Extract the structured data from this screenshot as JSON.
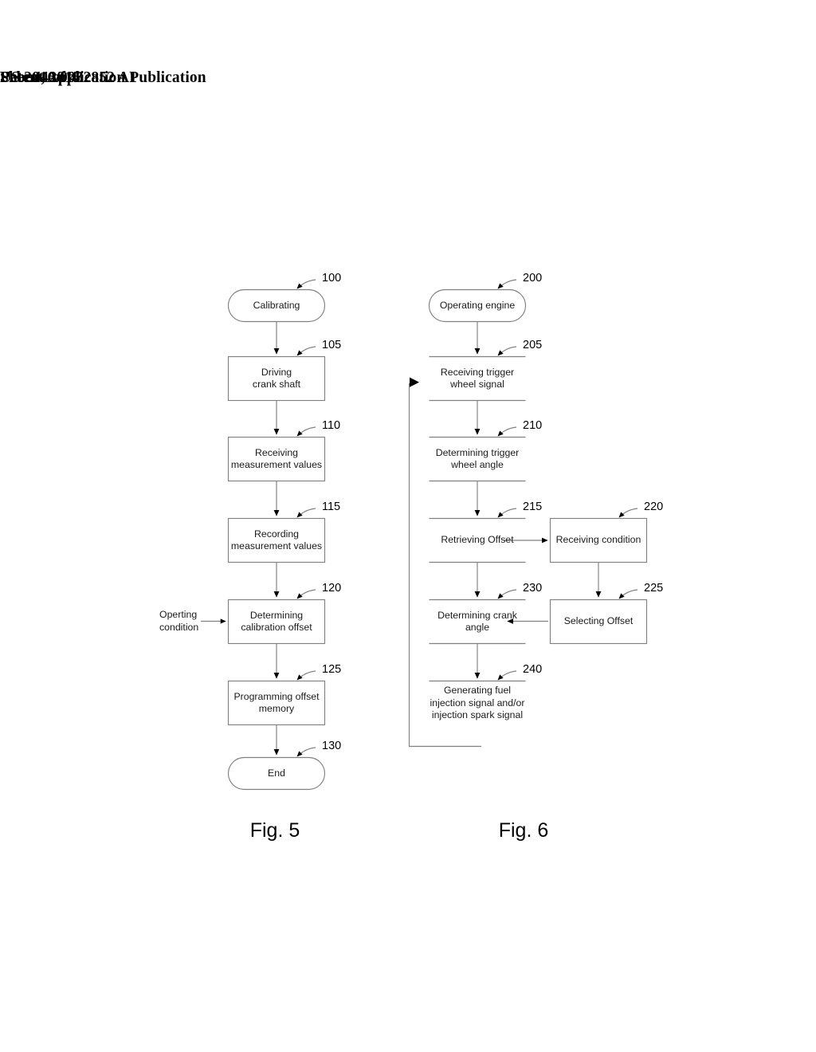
{
  "header": {
    "publication": "Patent Application Publication",
    "date": "Feb. 4, 2016",
    "sheet": "Sheet 4 of 4",
    "patent_number": "US 2016/0032852 A1"
  },
  "colors": {
    "line": "#808080",
    "arrow": "#000000",
    "text": "#1a1a1a",
    "background": "#ffffff"
  },
  "figures": [
    {
      "id": "fig5",
      "caption": "Fig. 5",
      "nodes": [
        {
          "ref": "100",
          "label": "Calibrating",
          "shape": "stadium"
        },
        {
          "ref": "105",
          "label": "Driving\ncrank shaft",
          "shape": "rect"
        },
        {
          "ref": "110",
          "label": "Receiving\nmeasurement values",
          "shape": "rect"
        },
        {
          "ref": "115",
          "label": "Recording\nmeasurement values",
          "shape": "rect"
        },
        {
          "ref": "120",
          "label": "Determining\ncalibration offset",
          "shape": "rect"
        },
        {
          "ref": "125",
          "label": "Programming offset\nmemory",
          "shape": "rect"
        },
        {
          "ref": "130",
          "label": "End",
          "shape": "stadium"
        }
      ],
      "side_inputs": [
        {
          "label": "Operting\ncondition",
          "target_ref": "120"
        }
      ]
    },
    {
      "id": "fig6",
      "caption": "Fig. 6",
      "nodes": [
        {
          "ref": "200",
          "label": "Operating engine",
          "shape": "stadium"
        },
        {
          "ref": "205",
          "label": "Receiving trigger\nwheel signal",
          "shape": "openrect"
        },
        {
          "ref": "210",
          "label": "Determining trigger\nwheel angle",
          "shape": "openrect"
        },
        {
          "ref": "215",
          "label": "Retrieving Offset",
          "shape": "openrect"
        },
        {
          "ref": "220",
          "label": "Receiving condition",
          "shape": "rect"
        },
        {
          "ref": "225",
          "label": "Selecting Offset",
          "shape": "rect"
        },
        {
          "ref": "230",
          "label": "Determining crank\nangle",
          "shape": "openrect"
        },
        {
          "ref": "240",
          "label": "Generating fuel\ninjection signal and/or\ninjection spark signal",
          "shape": "openrect"
        }
      ],
      "feedback_loop": {
        "from_ref": "240",
        "to_ref": "205"
      }
    }
  ]
}
